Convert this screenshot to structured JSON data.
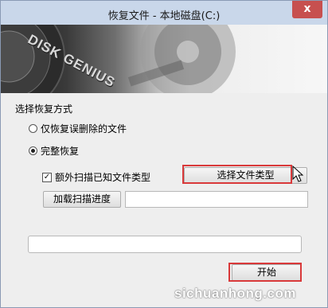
{
  "window": {
    "title": "恢复文件 - 本地磁盘(C:)",
    "close_glyph": "x"
  },
  "banner": {
    "logo_text": "DISK GENIUS"
  },
  "recovery_mode": {
    "section_title": "选择恢复方式",
    "options": [
      {
        "label": "仅恢复误删除的文件",
        "selected": false
      },
      {
        "label": "完整恢复",
        "selected": true
      }
    ],
    "extra_scan": {
      "label": "额外扫描已知文件类型",
      "checked": true
    },
    "select_file_types_button": "选择文件类型",
    "load_progress_button": "加载扫描进度",
    "load_progress_path": "",
    "progress_field": ""
  },
  "start_button": "开始",
  "watermark": "sichuanhong.com",
  "colors": {
    "highlight": "#d9393a",
    "close_button": "#c7504f",
    "titlebar": "#c9d7ea"
  }
}
